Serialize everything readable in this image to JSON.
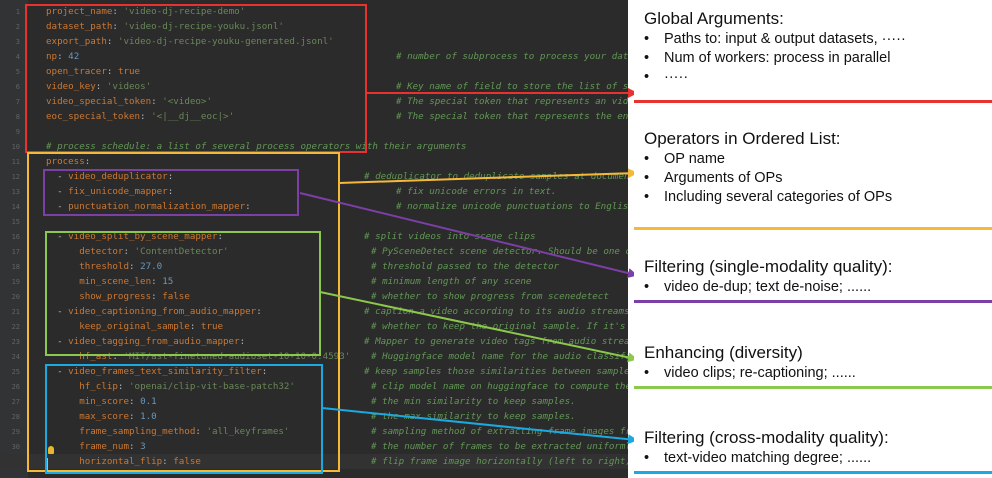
{
  "colors": {
    "global": "#e8322f",
    "operators": "#f5b93a",
    "single_modality": "#7b3fa6",
    "enhancing": "#8cc84b",
    "cross_modality": "#1aa9e0"
  },
  "editor": {
    "line_numbers": [
      "1",
      "2",
      "3",
      "4",
      "5",
      "6",
      "7",
      "8",
      "9",
      "10",
      "11",
      "12",
      "13",
      "14",
      "15",
      "16",
      "17",
      "18",
      "19",
      "20",
      "21",
      "22",
      "23",
      "24",
      "25",
      "26",
      "27",
      "28",
      "29",
      "30",
      "31"
    ],
    "lines": [
      [
        {
          "t": "project_name",
          "c": "k"
        },
        {
          "t": ": ",
          "c": "p"
        },
        {
          "t": "'video-dj-recipe-demo'",
          "c": "v"
        }
      ],
      [
        {
          "t": "dataset_path",
          "c": "k"
        },
        {
          "t": ": ",
          "c": "p"
        },
        {
          "t": "'video-dj-recipe-youku.jsonl'",
          "c": "v"
        }
      ],
      [
        {
          "t": "export_path",
          "c": "k"
        },
        {
          "t": ": ",
          "c": "p"
        },
        {
          "t": "'video-dj-recipe-youku-generated.jsonl'",
          "c": "v"
        }
      ],
      [
        {
          "t": "np",
          "c": "k"
        },
        {
          "t": ": ",
          "c": "p"
        },
        {
          "t": "42",
          "c": "n"
        }
      ],
      [
        {
          "t": "open_tracer",
          "c": "k"
        },
        {
          "t": ": ",
          "c": "p"
        },
        {
          "t": "true",
          "c": "k"
        }
      ],
      [
        {
          "t": "video_key",
          "c": "k"
        },
        {
          "t": ": ",
          "c": "p"
        },
        {
          "t": "'videos'",
          "c": "v"
        }
      ],
      [
        {
          "t": "video_special_token",
          "c": "k"
        },
        {
          "t": ": ",
          "c": "p"
        },
        {
          "t": "'<video>'",
          "c": "v"
        }
      ],
      [
        {
          "t": "eoc_special_token",
          "c": "k"
        },
        {
          "t": ": ",
          "c": "p"
        },
        {
          "t": "'<|__dj__eoc|>'",
          "c": "v"
        }
      ],
      [],
      [],
      [
        {
          "t": "process",
          "c": "k"
        },
        {
          "t": ":",
          "c": "p"
        }
      ],
      [
        {
          "t": "  - ",
          "c": "p"
        },
        {
          "t": "video_deduplicator",
          "c": "k"
        },
        {
          "t": ":",
          "c": "p"
        }
      ],
      [
        {
          "t": "  - ",
          "c": "p"
        },
        {
          "t": "fix_unicode_mapper",
          "c": "k"
        },
        {
          "t": ":",
          "c": "p"
        }
      ],
      [
        {
          "t": "  - ",
          "c": "p"
        },
        {
          "t": "punctuation_normalization_mapper",
          "c": "k"
        },
        {
          "t": ":",
          "c": "p"
        }
      ],
      [],
      [
        {
          "t": "  - ",
          "c": "p"
        },
        {
          "t": "video_split_by_scene_mapper",
          "c": "k"
        },
        {
          "t": ":",
          "c": "p"
        }
      ],
      [
        {
          "t": "      detector",
          "c": "k"
        },
        {
          "t": ": ",
          "c": "p"
        },
        {
          "t": "'ContentDetector'",
          "c": "v"
        }
      ],
      [
        {
          "t": "      threshold",
          "c": "k"
        },
        {
          "t": ": ",
          "c": "p"
        },
        {
          "t": "27.0",
          "c": "n"
        }
      ],
      [
        {
          "t": "      min_scene_len",
          "c": "k"
        },
        {
          "t": ": ",
          "c": "p"
        },
        {
          "t": "15",
          "c": "n"
        }
      ],
      [
        {
          "t": "      show_progress",
          "c": "k"
        },
        {
          "t": ": ",
          "c": "p"
        },
        {
          "t": "false",
          "c": "k"
        }
      ],
      [
        {
          "t": "  - ",
          "c": "p"
        },
        {
          "t": "video_captioning_from_audio_mapper",
          "c": "k"
        },
        {
          "t": ":",
          "c": "p"
        }
      ],
      [
        {
          "t": "      keep_original_sample",
          "c": "k"
        },
        {
          "t": ": ",
          "c": "p"
        },
        {
          "t": "true",
          "c": "k"
        }
      ],
      [
        {
          "t": "  - ",
          "c": "p"
        },
        {
          "t": "video_tagging_from_audio_mapper",
          "c": "k"
        },
        {
          "t": ":",
          "c": "p"
        }
      ],
      [
        {
          "t": "      hf_ast",
          "c": "k"
        },
        {
          "t": ": ",
          "c": "p"
        },
        {
          "t": "'MIT/ast-finetuned-audioset-10-10-0.4593'",
          "c": "v"
        }
      ],
      [
        {
          "t": "  - ",
          "c": "p"
        },
        {
          "t": "video_frames_text_similarity_filter",
          "c": "k"
        },
        {
          "t": ":",
          "c": "p"
        }
      ],
      [
        {
          "t": "      hf_clip",
          "c": "k"
        },
        {
          "t": ": ",
          "c": "p"
        },
        {
          "t": "'openai/clip-vit-base-patch32'",
          "c": "v"
        }
      ],
      [
        {
          "t": "      min_score",
          "c": "k"
        },
        {
          "t": ": ",
          "c": "p"
        },
        {
          "t": "0.1",
          "c": "n"
        }
      ],
      [
        {
          "t": "      max_score",
          "c": "k"
        },
        {
          "t": ": ",
          "c": "p"
        },
        {
          "t": "1.0",
          "c": "n"
        }
      ],
      [
        {
          "t": "      frame_sampling_method",
          "c": "k"
        },
        {
          "t": ": ",
          "c": "p"
        },
        {
          "t": "'all_keyframes'",
          "c": "v"
        }
      ],
      [
        {
          "t": "      frame_num",
          "c": "k"
        },
        {
          "t": ": ",
          "c": "p"
        },
        {
          "t": "3",
          "c": "n"
        }
      ],
      [
        {
          "t": "      horizontal_flip",
          "c": "k"
        },
        {
          "t": ": ",
          "c": "p"
        },
        {
          "t": "false",
          "c": "k"
        }
      ]
    ],
    "comments": [
      {
        "line": 4,
        "text": "# number of subprocess to process your dataset"
      },
      {
        "line": 6,
        "text": "# Key name of field to store the list of sample video paths."
      },
      {
        "line": 7,
        "text": "# The special token that represents an video in the text."
      },
      {
        "line": 8,
        "text": "# The special token that represents the end of a chunk in the text."
      },
      {
        "line": 10,
        "text": "# process schedule: a list of several process operators with their arguments"
      },
      {
        "line": 12,
        "text": "# deduplicator to deduplicate samples at document-level"
      },
      {
        "line": 13,
        "text": "# fix unicode errors in text."
      },
      {
        "line": 14,
        "text": "# normalize unicode punctuations to English punctuations."
      },
      {
        "line": 16,
        "text": "# split videos into scene clips"
      },
      {
        "line": 17,
        "text": "# PySceneDetect scene detector. Should be one of"
      },
      {
        "line": 18,
        "text": "# threshold passed to the detector"
      },
      {
        "line": 19,
        "text": "# minimum length of any scene"
      },
      {
        "line": 20,
        "text": "# whether to show progress from scenedetect"
      },
      {
        "line": 21,
        "text": "# caption a video according to its audio streams"
      },
      {
        "line": 22,
        "text": "# whether to keep the original sample. If it's set"
      },
      {
        "line": 23,
        "text": "# Mapper to generate video tags from audio streams"
      },
      {
        "line": 24,
        "text": "# Huggingface model name for the audio classification"
      },
      {
        "line": 25,
        "text": "# keep samples those similarities between sampled"
      },
      {
        "line": 26,
        "text": "# clip model name on huggingface to compute the"
      },
      {
        "line": 27,
        "text": "# the min similarity to keep samples."
      },
      {
        "line": 28,
        "text": "# the max similarity to keep samples."
      },
      {
        "line": 29,
        "text": "# sampling method of extracting frame images from"
      },
      {
        "line": 30,
        "text": "# the number of frames to be extracted uniformly"
      },
      {
        "line": 31,
        "text": "# flip frame image horizontally (left to right)."
      }
    ]
  },
  "cards": [
    {
      "id": "global",
      "title": "Global Arguments:",
      "items": [
        "Paths to: input & output datasets, ·····",
        "Num of workers: process in parallel",
        "·····"
      ]
    },
    {
      "id": "operators",
      "title": "Operators in Ordered List:",
      "items": [
        "OP name",
        "Arguments of OPs",
        "Including several categories of OPs"
      ]
    },
    {
      "id": "single",
      "title": "Filtering (single-modality quality):",
      "items": [
        "video de-dup; text de-noise; ......"
      ]
    },
    {
      "id": "enhancing",
      "title": "Enhancing (diversity)",
      "items": [
        "video clips; re-captioning; ......"
      ]
    },
    {
      "id": "cross",
      "title": "Filtering (cross-modality quality):",
      "items": [
        "text-video matching degree; ......"
      ]
    }
  ]
}
